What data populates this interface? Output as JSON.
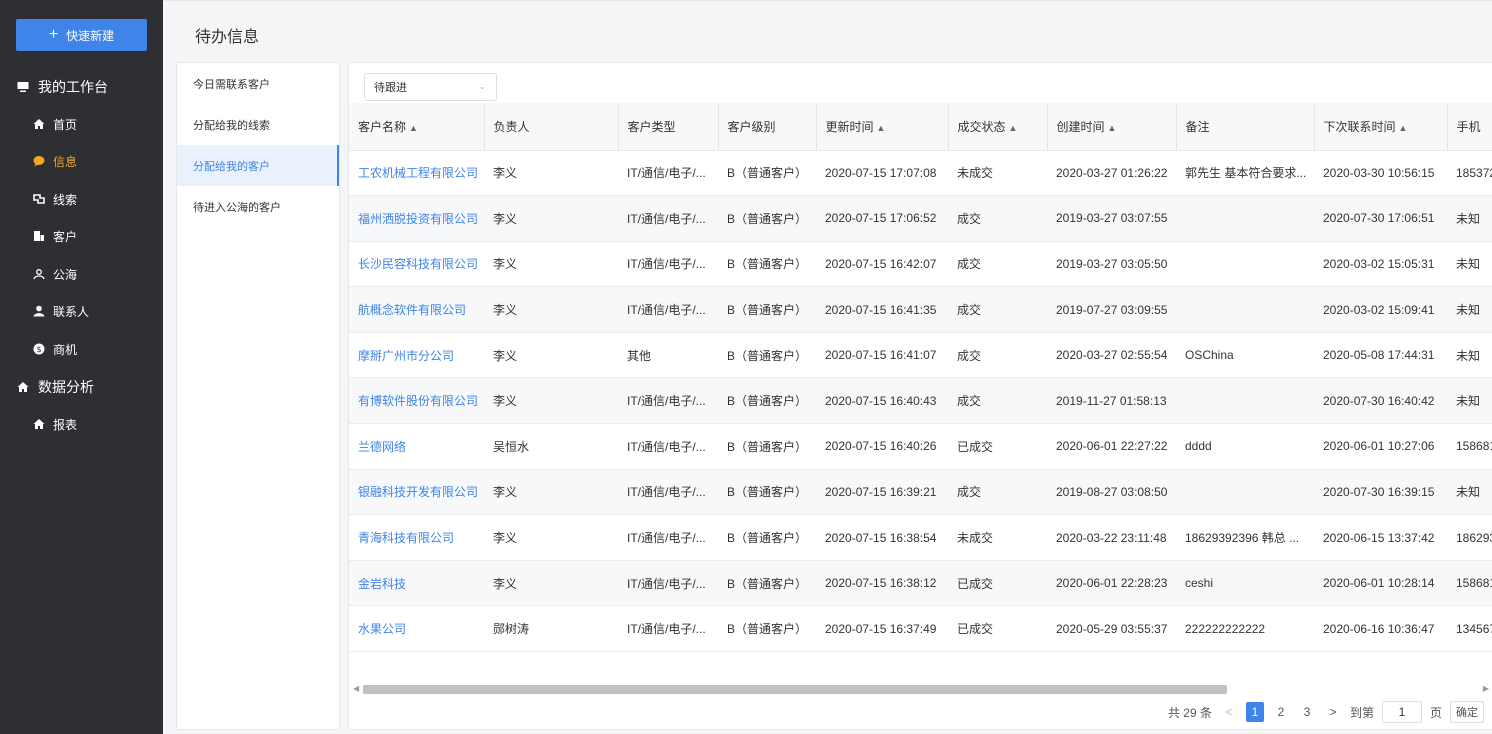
{
  "sidebar": {
    "quick_new": "快速新建",
    "workbench": "我的工作台",
    "items": [
      {
        "label": "首页",
        "icon": "home-icon"
      },
      {
        "label": "信息",
        "icon": "message-icon"
      },
      {
        "label": "线索",
        "icon": "clue-icon"
      },
      {
        "label": "客户",
        "icon": "customer-icon"
      },
      {
        "label": "公海",
        "icon": "pool-icon"
      },
      {
        "label": "联系人",
        "icon": "contact-icon"
      },
      {
        "label": "商机",
        "icon": "opportunity-icon"
      }
    ],
    "analytics": "数据分析",
    "report": "报表",
    "active_color": "#f5a623",
    "bg_color": "#2d2f33"
  },
  "header": {
    "title": "待办信息"
  },
  "left_panel": {
    "items": [
      "今日需联系客户",
      "分配给我的线索",
      "分配给我的客户",
      "待进入公海的客户"
    ],
    "active_index": 2
  },
  "filter": {
    "value": "待跟进"
  },
  "table": {
    "columns": [
      "客户名称",
      "负责人",
      "客户类型",
      "客户级别",
      "更新时间",
      "成交状态",
      "创建时间",
      "备注",
      "下次联系时间",
      "手机"
    ],
    "rows": [
      [
        "工农机械工程有限公司",
        "李义",
        "IT/通信/电子/...",
        "B（普通客户）",
        "2020-07-15 17:07:08",
        "未成交",
        "2020-03-27 01:26:22",
        "郭先生 基本符合要求...",
        "2020-03-30 10:56:15",
        "185372"
      ],
      [
        "福州洒脱投资有限公司",
        "李义",
        "IT/通信/电子/...",
        "B（普通客户）",
        "2020-07-15 17:06:52",
        "成交",
        "2019-03-27 03:07:55",
        "",
        "2020-07-30 17:06:51",
        "未知"
      ],
      [
        "长沙民容科技有限公司",
        "李义",
        "IT/通信/电子/...",
        "B（普通客户）",
        "2020-07-15 16:42:07",
        "成交",
        "2019-03-27 03:05:50",
        "",
        "2020-03-02 15:05:31",
        "未知"
      ],
      [
        "航概念软件有限公司",
        "李义",
        "IT/通信/电子/...",
        "B（普通客户）",
        "2020-07-15 16:41:35",
        "成交",
        "2019-07-27 03:09:55",
        "",
        "2020-03-02 15:09:41",
        "未知"
      ],
      [
        "摩掰广州市分公司",
        "李义",
        "其他",
        "B（普通客户）",
        "2020-07-15 16:41:07",
        "成交",
        "2020-03-27 02:55:54",
        "OSChina",
        "2020-05-08 17:44:31",
        "未知"
      ],
      [
        "有博软件股份有限公司",
        "李义",
        "IT/通信/电子/...",
        "B（普通客户）",
        "2020-07-15 16:40:43",
        "成交",
        "2019-11-27 01:58:13",
        "",
        "2020-07-30 16:40:42",
        "未知"
      ],
      [
        "兰德网络",
        "吴恒水",
        "IT/通信/电子/...",
        "B（普通客户）",
        "2020-07-15 16:40:26",
        "已成交",
        "2020-06-01 22:27:22",
        "dddd",
        "2020-06-01 10:27:06",
        "158681"
      ],
      [
        "银融科技开发有限公司",
        "李义",
        "IT/通信/电子/...",
        "B（普通客户）",
        "2020-07-15 16:39:21",
        "成交",
        "2019-08-27 03:08:50",
        "",
        "2020-07-30 16:39:15",
        "未知"
      ],
      [
        "青海科技有限公司",
        "李义",
        "IT/通信/电子/...",
        "B（普通客户）",
        "2020-07-15 16:38:54",
        "未成交",
        "2020-03-22 23:11:48",
        "18629392396 韩总 ...",
        "2020-06-15 13:37:42",
        "186293"
      ],
      [
        "金岩科技",
        "李义",
        "IT/通信/电子/...",
        "B（普通客户）",
        "2020-07-15 16:38:12",
        "已成交",
        "2020-06-01 22:28:23",
        "ceshi",
        "2020-06-01 10:28:14",
        "158681"
      ],
      [
        "水果公司",
        "郧树涛",
        "IT/通信/电子/...",
        "B（普通客户）",
        "2020-07-15 16:37:49",
        "已成交",
        "2020-05-29 03:55:37",
        "222222222222",
        "2020-06-16 10:36:47",
        "134567"
      ]
    ]
  },
  "pager": {
    "total": "共 29 条",
    "prev": "<",
    "pages": [
      "1",
      "2",
      "3"
    ],
    "next": ">",
    "goto_label": "到第",
    "goto_value": "1",
    "page_unit": "页",
    "confirm": "确定"
  },
  "accent_color": "#3e84e9"
}
